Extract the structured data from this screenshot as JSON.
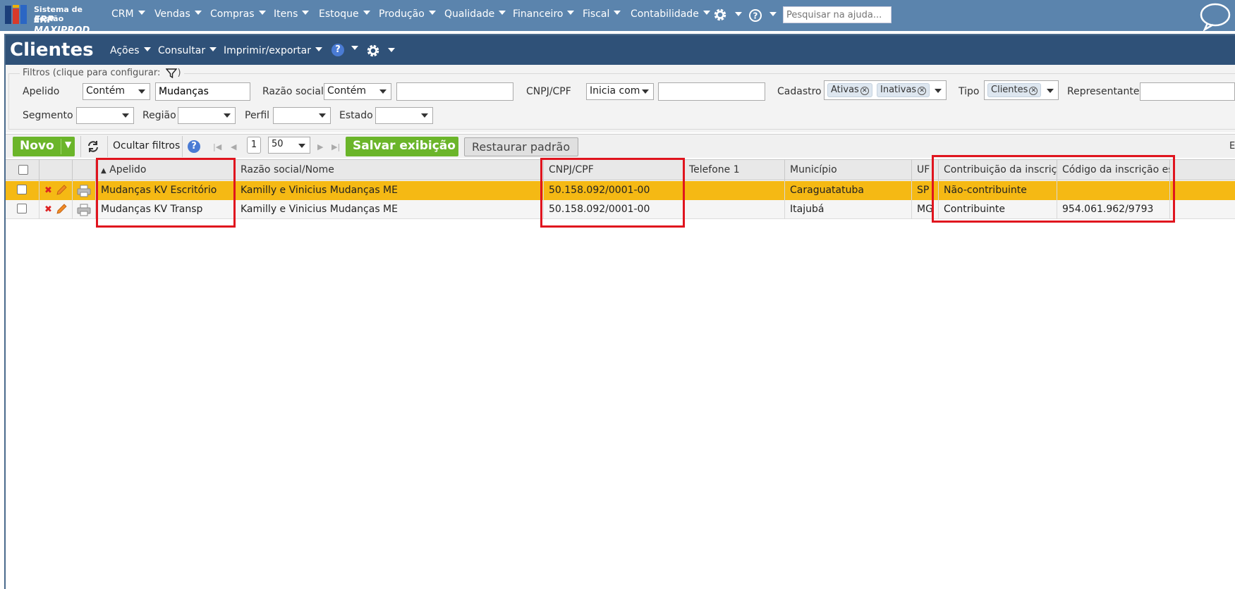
{
  "brand": {
    "line1": "Sistema de gestão",
    "line2": "ERP MAXIPROD"
  },
  "topnav": {
    "items": [
      "CRM",
      "Vendas",
      "Compras",
      "Itens",
      "Estoque",
      "Produção",
      "Qualidade",
      "Financeiro",
      "Fiscal",
      "Contabilidade"
    ],
    "search_placeholder": "Pesquisar na ajuda..."
  },
  "page": {
    "title": "Clientes",
    "menu": [
      "Ações",
      "Consultar",
      "Imprimir/exportar"
    ]
  },
  "filters": {
    "legend": "Filtros (clique para configurar:",
    "legend_close": ")",
    "apelido": {
      "label": "Apelido",
      "op": "Contém",
      "value": "Mudanças"
    },
    "razao_social": {
      "label": "Razão social",
      "op": "Contém",
      "value": ""
    },
    "cnpj": {
      "label": "CNPJ/CPF",
      "op": "Inicia com",
      "value": ""
    },
    "cadastro": {
      "label": "Cadastro",
      "tags": [
        "Ativas",
        "Inativas"
      ]
    },
    "tipo": {
      "label": "Tipo",
      "tags": [
        "Clientes"
      ]
    },
    "representante": {
      "label": "Representante",
      "value": ""
    },
    "segmento": {
      "label": "Segmento",
      "value": ""
    },
    "regiao": {
      "label": "Região",
      "value": ""
    },
    "perfil": {
      "label": "Perfil",
      "value": ""
    },
    "estado": {
      "label": "Estado",
      "value": ""
    }
  },
  "toolbar": {
    "novo": "Novo",
    "novo_drop": "▼",
    "hide_filters": "Ocultar filtros",
    "page_number": "1",
    "page_size": "50",
    "save_view": "Salvar exibição",
    "restore_default": "Restaurar padrão",
    "export_partial": "Ex"
  },
  "grid": {
    "columns": [
      "Apelido",
      "Razão social/Nome",
      "CNPJ/CPF",
      "Telefone 1",
      "Município",
      "UF",
      "Contribuição da inscriçã",
      "Código da inscrição est"
    ],
    "sort_indicator": "▲",
    "rows": [
      {
        "apelido": "Mudanças KV Escritório",
        "razao": "Kamilly e Vinicius Mudanças ME",
        "cnpj": "50.158.092/0001-00",
        "telefone": "",
        "municipio": "Caraguatatuba",
        "uf": "SP",
        "contribuicao": "Não-contribuinte",
        "codigo": ""
      },
      {
        "apelido": "Mudanças KV Transp",
        "razao": "Kamilly e Vinicius Mudanças ME",
        "cnpj": "50.158.092/0001-00",
        "telefone": "",
        "municipio": "Itajubá",
        "uf": "MG",
        "contribuicao": "Contribuinte",
        "codigo": "954.061.962/9793"
      }
    ]
  },
  "colors": {
    "topnav": "#5b84ad",
    "titlebar": "#2f5178",
    "selected_row": "#f5b914",
    "accent_green": "#6bb52a",
    "highlight": "#e0141e"
  }
}
